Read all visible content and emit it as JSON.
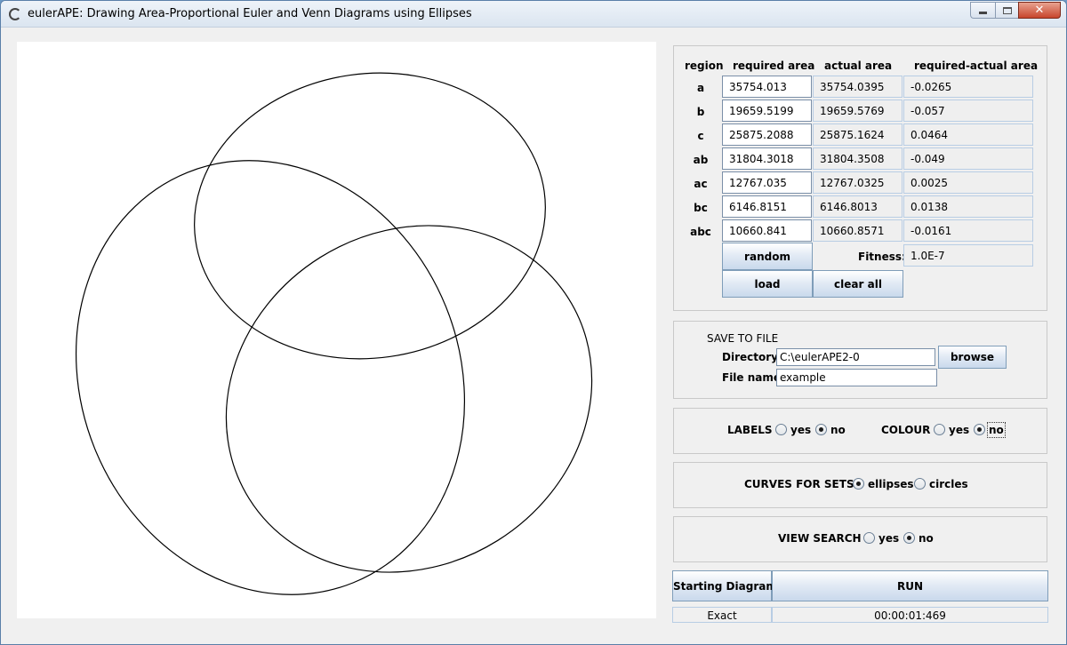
{
  "window": {
    "title": "eulerAPE: Drawing Area-Proportional Euler and Venn Diagrams using Ellipses",
    "controls": {
      "close_glyph": "✕"
    }
  },
  "table": {
    "headers": [
      "region",
      "required area",
      "actual area",
      "required-actual area"
    ],
    "rows": [
      {
        "region": "a",
        "required": "35754.013",
        "actual": "35754.0395",
        "diff": "-0.0265"
      },
      {
        "region": "b",
        "required": "19659.5199",
        "actual": "19659.5769",
        "diff": "-0.057"
      },
      {
        "region": "c",
        "required": "25875.2088",
        "actual": "25875.1624",
        "diff": "0.0464"
      },
      {
        "region": "ab",
        "required": "31804.3018",
        "actual": "31804.3508",
        "diff": "-0.049"
      },
      {
        "region": "ac",
        "required": "12767.035",
        "actual": "12767.0325",
        "diff": "0.0025"
      },
      {
        "region": "bc",
        "required": "6146.8151",
        "actual": "6146.8013",
        "diff": "0.0138"
      },
      {
        "region": "abc",
        "required": "10660.841",
        "actual": "10660.8571",
        "diff": "-0.0161"
      }
    ],
    "random_label": "random",
    "fitness_label": "Fitness:",
    "fitness_value": "1.0E-7",
    "load_label": "load",
    "clear_label": "clear all"
  },
  "save": {
    "heading": "SAVE TO FILE",
    "directory_label": "Directory",
    "directory_value": "C:\\eulerAPE2-0",
    "browse_label": "browse",
    "filename_label": "File name",
    "filename_value": "example"
  },
  "labels_opt": {
    "label": "LABELS",
    "yes": "yes",
    "no": "no",
    "selected": "no"
  },
  "colour_opt": {
    "label": "COLOUR",
    "yes": "yes",
    "no": "no",
    "selected": "no"
  },
  "curves_opt": {
    "label": "CURVES FOR SETS",
    "ellipses": "ellipses",
    "circles": "circles",
    "selected": "ellipses"
  },
  "view_opt": {
    "label": "VIEW SEARCH",
    "yes": "yes",
    "no": "no",
    "selected": "no"
  },
  "actions": {
    "starting_label": "Starting Diagram",
    "run_label": "RUN"
  },
  "status": {
    "mode": "Exact",
    "elapsed": "00:00:01:469"
  }
}
